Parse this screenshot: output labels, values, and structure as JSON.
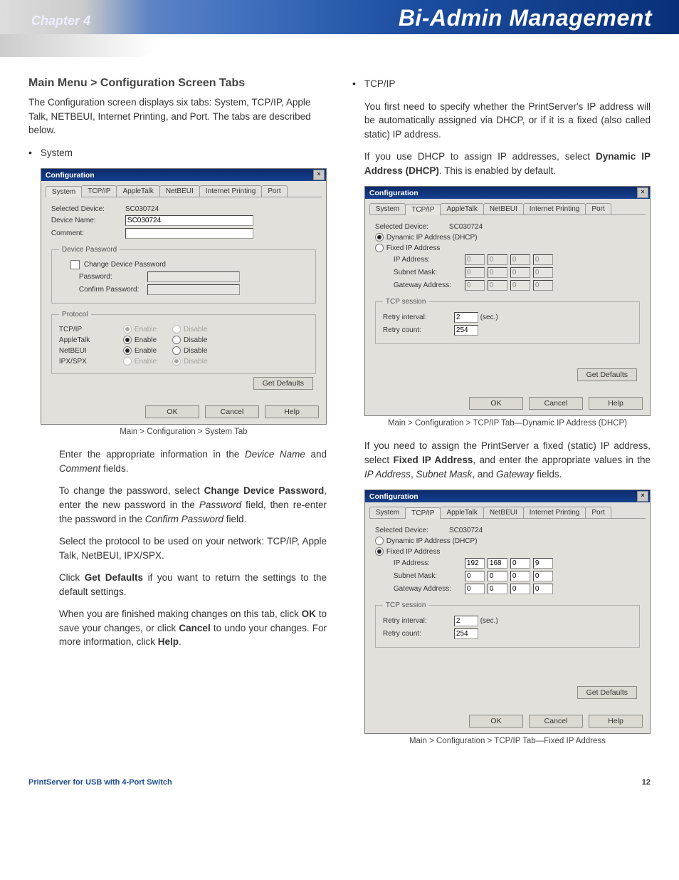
{
  "header": {
    "chapter": "Chapter 4",
    "title": "Bi-Admin Management"
  },
  "footer": {
    "product": "PrintServer for USB with 4-Port Switch",
    "page": "12"
  },
  "left": {
    "heading": "Main Menu > Configuration Screen Tabs",
    "intro": "The Configuration screen displays six tabs: System, TCP/IP, Apple Talk, NETBEUI, Internet Printing, and Port. The tabs are described below.",
    "bullet_system": "System",
    "caption": "Main > Configuration > System Tab",
    "p1a": "Enter the appropriate information in the ",
    "p1b": "Device Name",
    "p1c": " and ",
    "p1d": "Comment",
    "p1e": " fields.",
    "p2a": "To change the password, select ",
    "p2b": "Change Device Password",
    "p2c": ", enter the new password in the ",
    "p2d": "Password",
    "p2e": " field, then re-enter the password in the ",
    "p2f": "Confirm Password",
    "p2g": " field.",
    "p3": "Select the protocol to be used on your network: TCP/IP, Apple Talk, NetBEUI, IPX/SPX.",
    "p4a": "Click ",
    "p4b": "Get Defaults",
    "p4c": " if you want to return the settings to the default settings.",
    "p5a": "When you are finished making changes on this tab, click ",
    "p5b": "OK",
    "p5c": " to save your changes, or click ",
    "p5d": "Cancel",
    "p5e": " to undo your changes. For more information, click ",
    "p5f": "Help",
    "p5g": "."
  },
  "right": {
    "bullet_tcpip": "TCP/IP",
    "r1": "You first need to specify whether the PrintServer's IP address will be automatically assigned via DHCP, or if it is a fixed (also called static) IP address.",
    "r2a": "If you use DHCP to assign IP addresses, select ",
    "r2b": "Dynamic IP Address (DHCP)",
    "r2c": ". This is enabled by default.",
    "cap_dhcp": "Main > Configuration > TCP/IP Tab—Dynamic IP Address (DHCP)",
    "r3a": "If you need to assign the PrintServer a fixed (static) IP address, select ",
    "r3b": "Fixed IP Address",
    "r3c": ", and enter the appropriate values in the ",
    "r3d": "IP Address",
    "r3e": ", ",
    "r3f": "Subnet Mask",
    "r3g": ", and ",
    "r3h": "Gateway",
    "r3i": " fields.",
    "cap_fixed": "Main > Configuration > TCP/IP Tab—Fixed IP Address"
  },
  "win": {
    "title": "Configuration",
    "tabs": [
      "System",
      "TCP/IP",
      "AppleTalk",
      "NetBEUI",
      "Internet Printing",
      "Port"
    ],
    "selected_device_label": "Selected Device:",
    "selected_device_value": "SC030724",
    "device_name_label": "Device Name:",
    "device_name_value": "SC030724",
    "comment_label": "Comment:",
    "device_password_legend": "Device Password",
    "change_pw_label": "Change Device Password",
    "password_label": "Password:",
    "confirm_label": "Confirm Password:",
    "protocol_legend": "Protocol",
    "protocols": [
      "TCP/IP",
      "AppleTalk",
      "NetBEUI",
      "IPX/SPX"
    ],
    "enable": "Enable",
    "disable": "Disable",
    "get_defaults": "Get Defaults",
    "ok": "OK",
    "cancel": "Cancel",
    "help": "Help",
    "dhcp_label": "Dynamic IP Address (DHCP)",
    "fixed_label": "Fixed IP Address",
    "ip_label": "IP Address:",
    "subnet_label": "Subnet Mask:",
    "gateway_label": "Gateway Address:",
    "tcp_session_legend": "TCP session",
    "retry_interval_label": "Retry interval:",
    "retry_interval_value": "2",
    "retry_interval_unit": "(sec.)",
    "retry_count_label": "Retry count:",
    "retry_count_value": "254",
    "fixed_ip": [
      "192",
      "168",
      "0",
      "9"
    ],
    "fixed_mask": [
      "0",
      "0",
      "0",
      "0"
    ],
    "fixed_gw": [
      "0",
      "0",
      "0",
      "0"
    ],
    "zero": "0"
  }
}
